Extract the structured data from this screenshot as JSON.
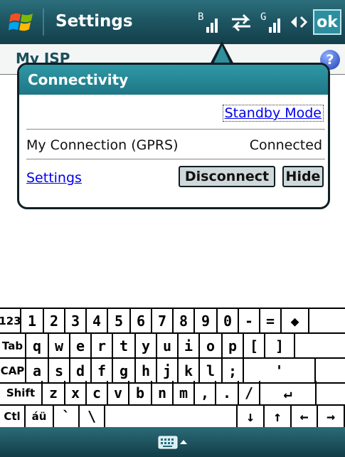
{
  "titlebar": {
    "title": "Settings",
    "ok_label": "ok",
    "icons": [
      "windows-start-icon",
      "signal-b-icon",
      "data-transfer-icon",
      "signal-g-icon",
      "speaker-icon"
    ]
  },
  "page": {
    "header_title": "My ISP"
  },
  "popup": {
    "title": "Connectivity",
    "standby_link": "Standby Mode",
    "connection_name": "My Connection (GPRS)",
    "connection_status": "Connected",
    "settings_link": "Settings",
    "disconnect_label": "Disconnect",
    "hide_label": "Hide"
  },
  "keyboard": {
    "rows": [
      [
        "123",
        "1",
        "2",
        "3",
        "4",
        "5",
        "6",
        "7",
        "8",
        "9",
        "0",
        "-",
        "=",
        "◆"
      ],
      [
        "Tab",
        "q",
        "w",
        "e",
        "r",
        "t",
        "y",
        "u",
        "i",
        "o",
        "p",
        "[",
        "]"
      ],
      [
        "CAP",
        "a",
        "s",
        "d",
        "f",
        "g",
        "h",
        "j",
        "k",
        "l",
        ";",
        "'"
      ],
      [
        "Shift",
        "z",
        "x",
        "c",
        "v",
        "b",
        "n",
        "m",
        ",",
        ".",
        "/",
        "↵"
      ],
      [
        "Ctl",
        "áü",
        "`",
        "\\",
        "",
        "↓",
        "↑",
        "←",
        "→"
      ]
    ]
  },
  "colors": {
    "titlebar": "#1e5663",
    "popup_header": "#2f98a5",
    "link": "#0000ee"
  }
}
